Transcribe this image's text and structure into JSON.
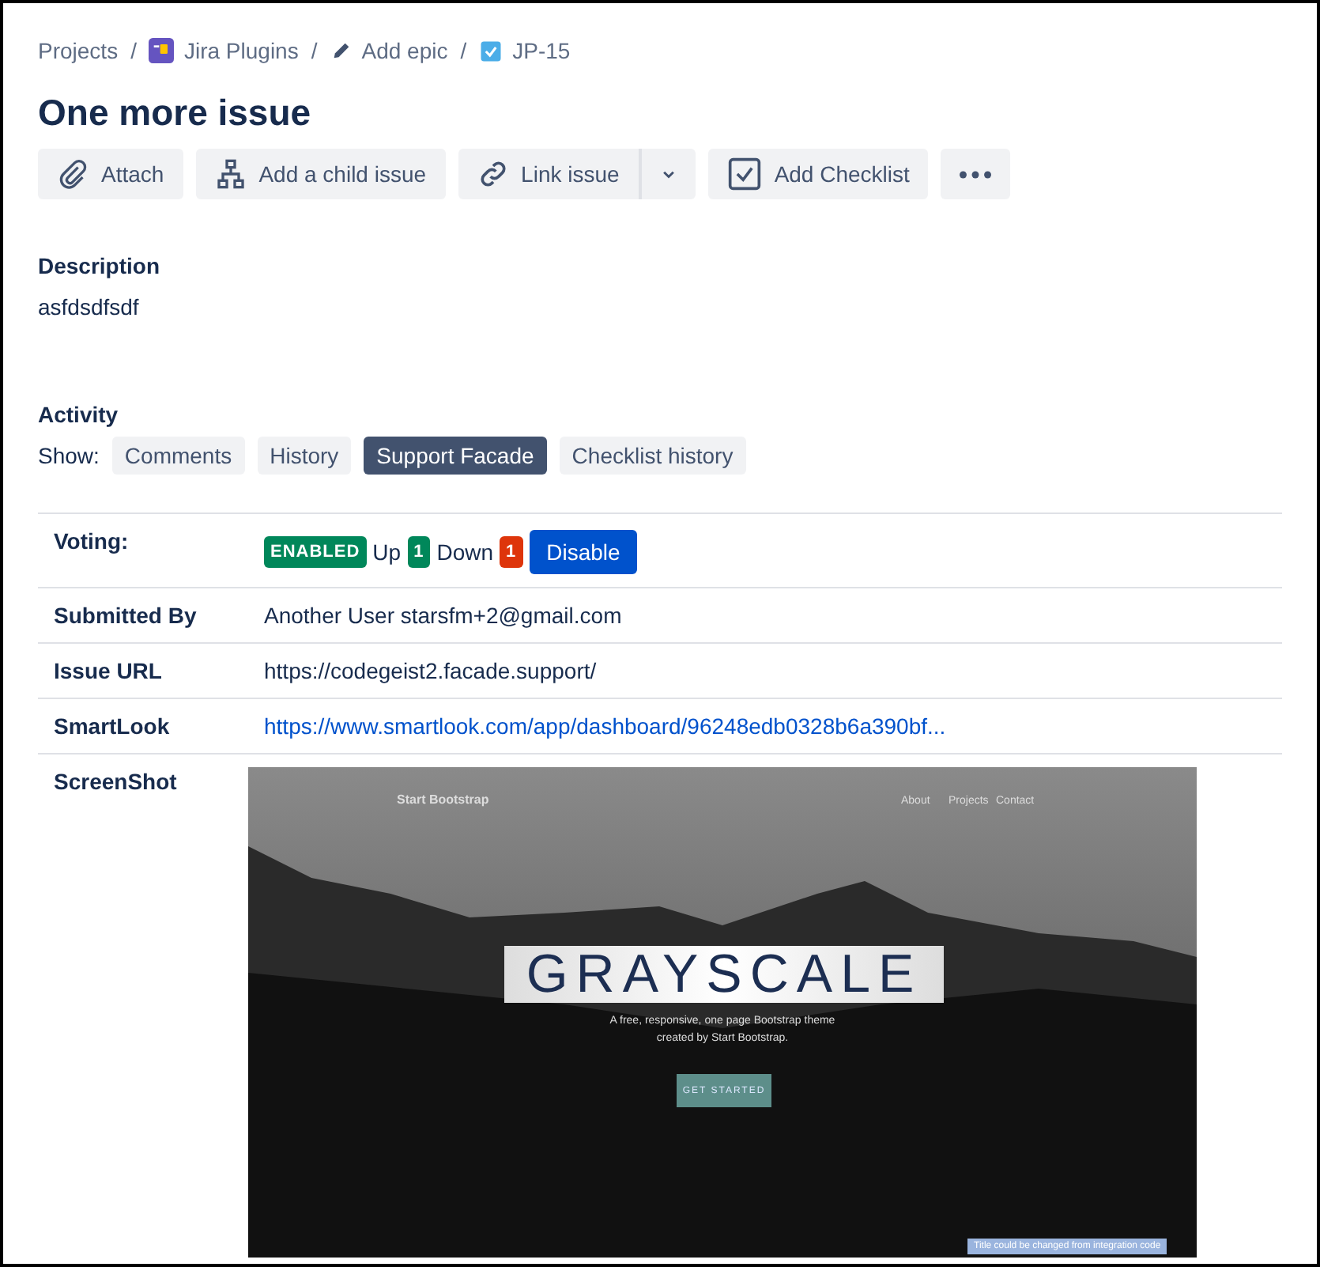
{
  "breadcrumbs": [
    {
      "label": "Projects",
      "kind": "plain"
    },
    {
      "label": "Jira Plugins",
      "kind": "project"
    },
    {
      "label": "Add epic",
      "kind": "epic"
    },
    {
      "label": "JP-15",
      "kind": "issue"
    }
  ],
  "breadcrumb_separator": "/",
  "title": "One more issue",
  "actions": [
    {
      "label": "Attach",
      "kind": "attach"
    },
    {
      "label": "Add a child issue",
      "kind": "child"
    },
    {
      "label": "Link issue",
      "kind": "link"
    },
    {
      "label": "Add Checklist",
      "kind": "checklist"
    }
  ],
  "description": {
    "heading": "Description",
    "text": "asfdsdfsdf"
  },
  "activity": {
    "heading": "Activity",
    "show_label": "Show:",
    "tabs": [
      {
        "label": "Comments",
        "selected": false
      },
      {
        "label": "History",
        "selected": false
      },
      {
        "label": "Support Facade",
        "selected": true
      },
      {
        "label": "Checklist history",
        "selected": false
      }
    ]
  },
  "fields": [
    {
      "kind": "voting",
      "label": "Voting:",
      "status": "ENABLED",
      "up_label": "Up",
      "up_count": "1",
      "down_label": "Down",
      "down_count": "1",
      "button": "Disable"
    },
    {
      "kind": "text",
      "label": "Submitted By",
      "value": "Another User starsfm+2@gmail.com"
    },
    {
      "kind": "text",
      "label": "Issue URL",
      "value": "https://codegeist2.facade.support/"
    },
    {
      "kind": "link",
      "label": "SmartLook",
      "value": "https://www.smartlook.com/app/dashboard/96248edb0328b6a390bf..."
    },
    {
      "kind": "screenshot",
      "label": "ScreenShot",
      "shot": {
        "brand": "Start Bootstrap",
        "nav": [
          "About",
          "Projects",
          "Contact"
        ],
        "headline": "GRAYSCALE",
        "tagline": "A free, responsive, one page Bootstrap theme created by Start Bootstrap.",
        "cta": "GET STARTED",
        "banner": "Title could be changed from integration code"
      }
    }
  ]
}
